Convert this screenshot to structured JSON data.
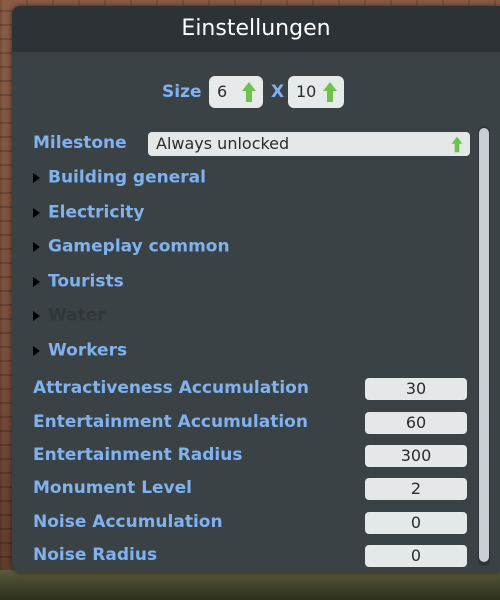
{
  "window": {
    "title": "Einstellungen"
  },
  "size": {
    "label": "Size",
    "separator": "X",
    "width": "6",
    "height": "10"
  },
  "milestone": {
    "label": "Milestone",
    "selected": "Always unlocked"
  },
  "sections": [
    {
      "label": "Building general",
      "enabled": true
    },
    {
      "label": "Electricity",
      "enabled": true
    },
    {
      "label": "Gameplay common",
      "enabled": true
    },
    {
      "label": "Tourists",
      "enabled": true
    },
    {
      "label": "Water",
      "enabled": false
    },
    {
      "label": "Workers",
      "enabled": true
    }
  ],
  "fields": [
    {
      "label": "Attractiveness Accumulation",
      "value": "30"
    },
    {
      "label": "Entertainment Accumulation",
      "value": "60"
    },
    {
      "label": "Entertainment Radius",
      "value": "300"
    },
    {
      "label": "Monument Level",
      "value": "2"
    },
    {
      "label": "Noise Accumulation",
      "value": "0"
    },
    {
      "label": "Noise Radius",
      "value": "0"
    }
  ],
  "colors": {
    "accent": "#7fb2ef",
    "panel": "#3b4245",
    "header": "#2c3235",
    "stepper_arrow": "#6cc24a"
  }
}
